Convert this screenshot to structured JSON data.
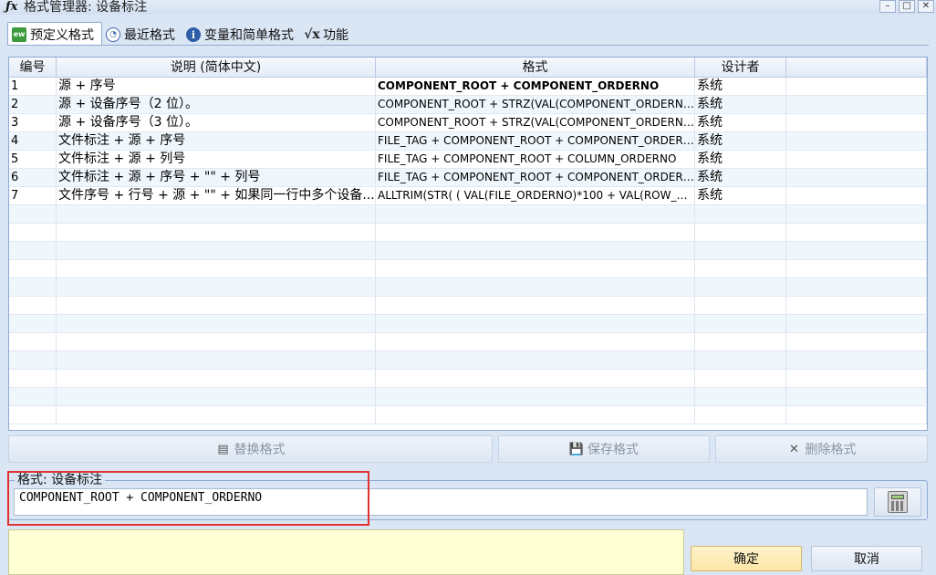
{
  "window": {
    "title": "格式管理器: 设备标注",
    "icon": "fx-icon"
  },
  "tabs": [
    {
      "label": "预定义格式",
      "icon": "predefined-icon",
      "active": true
    },
    {
      "label": "最近格式",
      "icon": "clock-icon"
    },
    {
      "label": "变量和简单格式",
      "icon": "info-icon"
    },
    {
      "label": "功能",
      "icon": "function-sqrt-icon"
    }
  ],
  "grid": {
    "columns": [
      "编号",
      "说明 (简体中文)",
      "格式",
      "设计者"
    ],
    "rows": [
      {
        "num": "1",
        "desc": "源 + 序号",
        "format": "COMPONENT_ROOT + COMPONENT_ORDERNO",
        "designer": "系统"
      },
      {
        "num": "2",
        "desc": "源 + 设备序号（2 位）。",
        "format": "COMPONENT_ROOT + STRZ(VAL(COMPONENT_ORDERNO)...",
        "designer": "系统"
      },
      {
        "num": "3",
        "desc": "源 + 设备序号（3 位）。",
        "format": "COMPONENT_ROOT + STRZ(VAL(COMPONENT_ORDERNO)...",
        "designer": "系统"
      },
      {
        "num": "4",
        "desc": "文件标注 + 源 + 序号",
        "format": "FILE_TAG + COMPONENT_ROOT + COMPONENT_ORDERNO",
        "designer": "系统"
      },
      {
        "num": "5",
        "desc": "文件标注 + 源 + 列号",
        "format": "FILE_TAG + COMPONENT_ROOT + COLUMN_ORDERNO",
        "designer": "系统"
      },
      {
        "num": "6",
        "desc": "文件标注 + 源 + 序号 + \"\" + 列号",
        "format": "FILE_TAG + COMPONENT_ROOT + COMPONENT_ORDERN...",
        "designer": "系统"
      },
      {
        "num": "7",
        "desc": "文件序号 + 行号 + 源 + \"\" + 如果同一行中多个设备...",
        "format": "ALLTRIM(STR( ( VAL(FILE_ORDERNO)*100 + VAL(ROW_O...",
        "designer": "系统"
      }
    ],
    "empty_rows": 12
  },
  "actions": {
    "replace": "替换格式",
    "save": "保存格式",
    "delete": "删除格式"
  },
  "format_group": {
    "legend": "格式: 设备标注",
    "value": "COMPONENT_ROOT + COMPONENT_ORDERNO"
  },
  "buttons": {
    "ok": "确定",
    "cancel": "取消"
  },
  "colors": {
    "highlight": "#e03030",
    "hint_bg": "#ffffd4",
    "ok_bg": "#fde7a6"
  }
}
